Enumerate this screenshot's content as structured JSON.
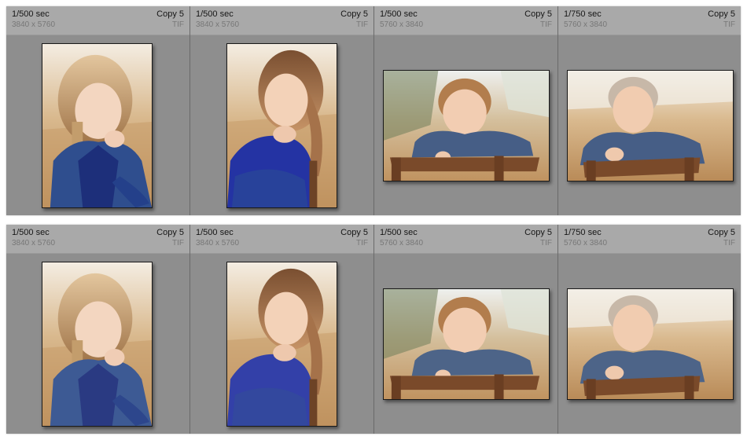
{
  "rows": [
    {
      "cells": [
        {
          "exposure": "1/500 sec",
          "copy": "Copy 5",
          "dims": "3840 x 5760",
          "type": "TIF"
        },
        {
          "exposure": "1/500 sec",
          "copy": "Copy 5",
          "dims": "3840 x 5760",
          "type": "TIF"
        },
        {
          "exposure": "1/500 sec",
          "copy": "Copy 5",
          "dims": "5760 x 3840",
          "type": "TIF"
        },
        {
          "exposure": "1/750 sec",
          "copy": "Copy 5",
          "dims": "5760 x 3840",
          "type": "TIF"
        }
      ]
    },
    {
      "cells": [
        {
          "exposure": "1/500 sec",
          "copy": "Copy 5",
          "dims": "3840 x 5760",
          "type": "TIF"
        },
        {
          "exposure": "1/500 sec",
          "copy": "Copy 5",
          "dims": "3840 x 5760",
          "type": "TIF"
        },
        {
          "exposure": "1/500 sec",
          "copy": "Copy 5",
          "dims": "5760 x 3840",
          "type": "TIF"
        },
        {
          "exposure": "1/750 sec",
          "copy": "Copy 5",
          "dims": "5760 x 3840",
          "type": "TIF"
        }
      ]
    }
  ],
  "colors": {
    "cell_bg": "#8e8e8e",
    "header_bg": "#a9a9a9",
    "text_primary": "#161616",
    "text_secondary": "#777777"
  }
}
